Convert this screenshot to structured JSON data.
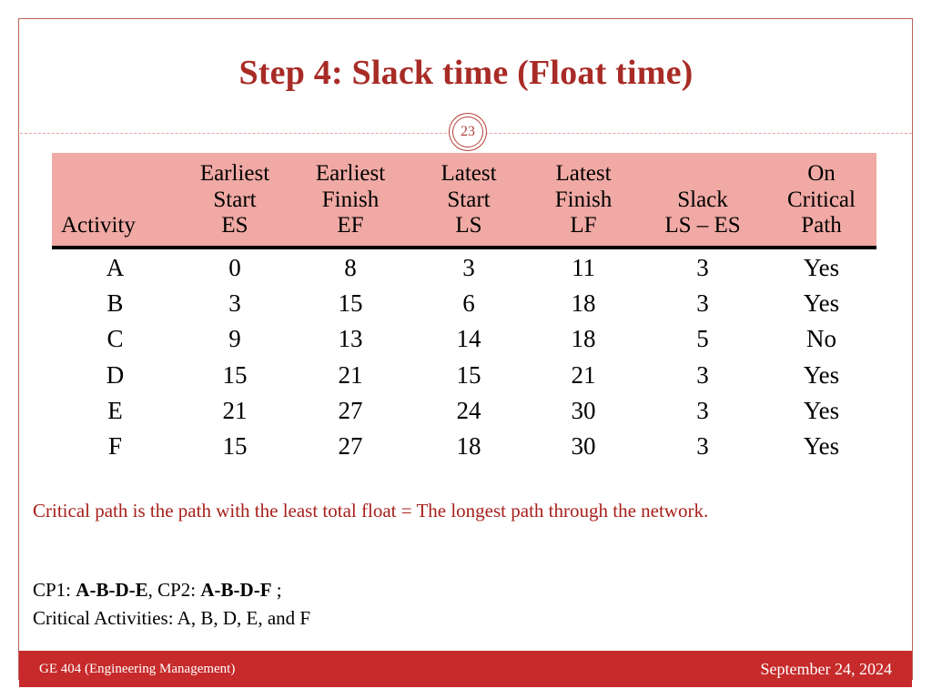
{
  "title": "Step 4: Slack time (Float time)",
  "page_number": "23",
  "colors": {
    "title_red": "#a82b26",
    "header_pink": "#f0a9a4",
    "value_blue": "#1a1ab0",
    "note_red": "#a8201b",
    "footer_red": "#c62a2a",
    "border_red": "#c0615c"
  },
  "table": {
    "headers": [
      {
        "lines": [
          "",
          "",
          "Activity"
        ]
      },
      {
        "lines": [
          "Earliest",
          "Start",
          "ES"
        ]
      },
      {
        "lines": [
          "Earliest",
          "Finish",
          "EF"
        ]
      },
      {
        "lines": [
          "Latest",
          "Start",
          "LS"
        ]
      },
      {
        "lines": [
          "Latest",
          "Finish",
          "LF"
        ]
      },
      {
        "lines": [
          "",
          "Slack",
          "LS – ES"
        ]
      },
      {
        "lines": [
          "On",
          "Critical",
          "Path"
        ]
      }
    ],
    "rows": [
      {
        "activity": "A",
        "es": "0",
        "ef": "8",
        "ls": "3",
        "lf": "11",
        "slack": "3",
        "critical": "Yes",
        "es_blue": true,
        "ls_blue": false
      },
      {
        "activity": "B",
        "es": "3",
        "ef": "15",
        "ls": "6",
        "lf": "18",
        "slack": "3",
        "critical": "Yes",
        "es_blue": true,
        "ls_blue": true
      },
      {
        "activity": "C",
        "es": "9",
        "ef": "13",
        "ls": "14",
        "lf": "18",
        "slack": "5",
        "critical": "No",
        "es_blue": true,
        "ls_blue": true
      },
      {
        "activity": "D",
        "es": "15",
        "ef": "21",
        "ls": "15",
        "lf": "21",
        "slack": "3",
        "critical": "Yes",
        "es_blue": true,
        "ls_blue": true
      },
      {
        "activity": "E",
        "es": "21",
        "ef": "27",
        "ls": "24",
        "lf": "30",
        "slack": "3",
        "critical": "Yes",
        "es_blue": true,
        "ls_blue": true
      },
      {
        "activity": "F",
        "es": "15",
        "ef": "27",
        "ls": "18",
        "lf": "30",
        "slack": "3",
        "critical": "Yes",
        "es_blue": true,
        "ls_blue": true
      }
    ]
  },
  "note": "Critical path is the path with the least total float = The longest path through the network.",
  "cp": {
    "line1_pre": "CP1: ",
    "line1_path1": "A-B-D-E",
    "line1_mid": ", CP2: ",
    "line1_path2": "A-B-D-F",
    "line1_post": " ;",
    "line2": "Critical Activities: A, B, D, E, and F"
  },
  "footer": {
    "course": "GE 404 (Engineering Management)",
    "date": "September 24, 2024"
  }
}
